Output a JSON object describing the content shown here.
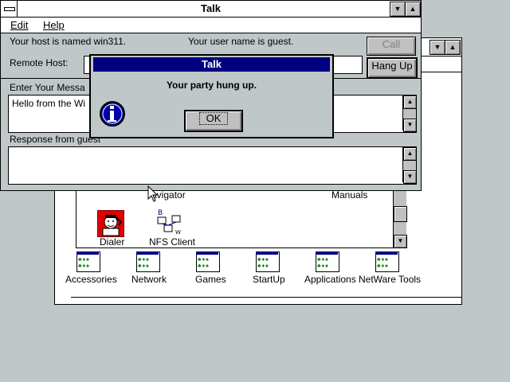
{
  "talk_window": {
    "title": "Talk",
    "menu": [
      "Edit",
      "Help"
    ],
    "host_text": "Your host is named win311.",
    "user_text": "Your user name is guest.",
    "remote_host_label": "Remote Host:",
    "call_button": "Call",
    "hangup_button": "Hang Up",
    "message_label": "Enter Your Messa",
    "message_text": "Hello from the Wi",
    "response_label": "Response from guest",
    "response_text": ""
  },
  "dialog": {
    "title": "Talk",
    "message": "Your party hung up.",
    "ok_button": "OK",
    "icon": "info-icon"
  },
  "background_window": {
    "inner_items": [
      {
        "label": "avigator",
        "icon": "navigator-icon"
      },
      {
        "label": "Manuals",
        "icon": "manuals-icon"
      },
      {
        "label": "Dialer",
        "icon": "dialer-icon"
      },
      {
        "label": "NFS Client",
        "icon": "nfs-client-icon"
      }
    ],
    "groups": [
      {
        "label": "Accessories"
      },
      {
        "label": "Network"
      },
      {
        "label": "Games"
      },
      {
        "label": "StartUp"
      },
      {
        "label": "Applications"
      },
      {
        "label": "NetWare Tools"
      }
    ]
  },
  "colors": {
    "desktop": "#c0c7c8",
    "active_caption": "#000080",
    "button_face": "#c0c0c0",
    "info_blue": "#0000a8"
  }
}
